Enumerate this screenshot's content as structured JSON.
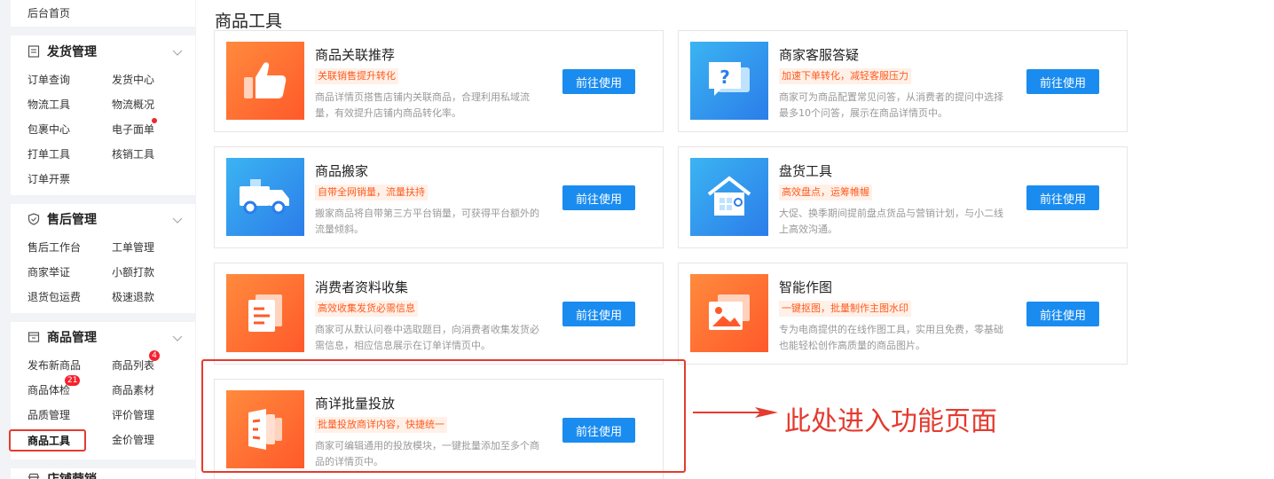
{
  "sidebar": {
    "home": "后台首页",
    "sections": [
      {
        "title": "发货管理",
        "icon": "document-icon",
        "items": [
          "订单查询",
          "发货中心",
          "物流工具",
          "物流概况",
          "包裹中心",
          "电子面单",
          "打单工具",
          "核销工具",
          "订单开票"
        ]
      },
      {
        "title": "售后管理",
        "icon": "shield-icon",
        "items": [
          "售后工作台",
          "工单管理",
          "商家举证",
          "小额打款",
          "退货包运费",
          "极速退款"
        ]
      },
      {
        "title": "商品管理",
        "icon": "box-icon",
        "items": [
          "发布新商品",
          "商品列表",
          "商品体检",
          "商品素材",
          "品质管理",
          "评价管理",
          "商品工具",
          "价管理"
        ]
      },
      {
        "title": "店铺营销",
        "icon": "store-icon"
      }
    ],
    "badges": {
      "product_list": "4",
      "product_check": "21"
    },
    "active_item_prefix": "金"
  },
  "main": {
    "title": "商品工具",
    "button_label": "前往使用",
    "cards": [
      {
        "title": "商品关联推荐",
        "tag": "关联销售提升转化",
        "desc": "商品详情页搭售店铺内关联商品，合理利用私域流量，有效提升店铺内商品转化率。",
        "icon": "thumbs-up-icon",
        "theme": "orange"
      },
      {
        "title": "商家客服答疑",
        "tag": "加速下单转化，减轻客服压力",
        "desc": "商家可为商品配置常见问答，从消费者的提问中选择最多10个问答，展示在商品详情页中。",
        "icon": "question-chat-icon",
        "theme": "blue"
      },
      {
        "title": "商品搬家",
        "tag": "自带全网销量，流量扶持",
        "desc": "搬家商品将自带第三方平台销量，可获得平台额外的流量倾斜。",
        "icon": "truck-icon",
        "theme": "blue"
      },
      {
        "title": "盘货工具",
        "tag": "高效盘点，运筹帷幄",
        "desc": "大促、换季期间提前盘点货品与营销计划，与小二线上高效沟通。",
        "icon": "warehouse-icon",
        "theme": "blue"
      },
      {
        "title": "消费者资料收集",
        "tag": "高效收集发货必需信息",
        "desc": "商家可从默认问卷中选取题目，向消费者收集发货必需信息，相应信息展示在订单详情页中。",
        "icon": "documents-icon",
        "theme": "orange"
      },
      {
        "title": "智能作图",
        "tag": "一键抠图，批量制作主图水印",
        "desc": "专为电商提供的在线作图工具，实用且免费，零基础也能轻松创作高质量的商品图片。",
        "icon": "image-icon",
        "theme": "orange"
      },
      {
        "title": "商详批量投放",
        "tag": "批量投放商详内容，快捷统一",
        "desc": "商家可编辑通用的投放模块，一键批量添加至多个商品的详情页中。",
        "icon": "panels-icon",
        "theme": "orange"
      }
    ]
  },
  "annotation": {
    "text": "此处进入功能页面",
    "color": "#e43b2f"
  },
  "colors": {
    "accent": "#1a8cf0",
    "orange": "#ff5a2a",
    "blue": "#2b7de9",
    "tag_text": "#ff5a1f"
  }
}
